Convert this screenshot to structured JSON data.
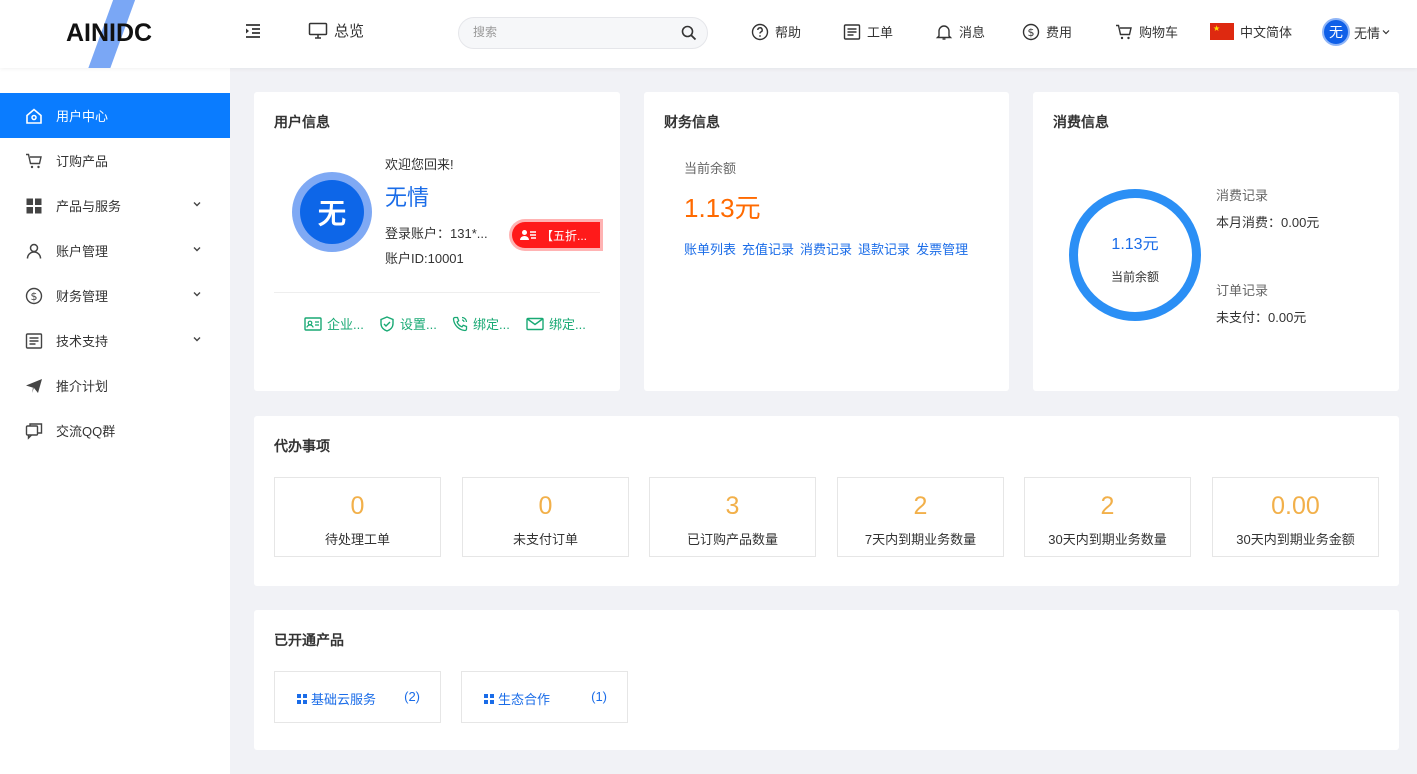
{
  "header": {
    "logo": "AINIDC",
    "overview": "总览",
    "search_placeholder": "搜索",
    "nav": {
      "help": "帮助",
      "ticket": "工单",
      "message": "消息",
      "cost": "费用",
      "cart": "购物车",
      "language": "中文简体",
      "user": "无情",
      "user_avatar": "无"
    }
  },
  "sidebar": {
    "items": [
      {
        "label": "用户中心",
        "icon": "home-icon",
        "active": true
      },
      {
        "label": "订购产品",
        "icon": "cart-icon"
      },
      {
        "label": "产品与服务",
        "icon": "grid-icon",
        "expandable": true
      },
      {
        "label": "账户管理",
        "icon": "user-icon",
        "expandable": true
      },
      {
        "label": "财务管理",
        "icon": "dollar-icon",
        "expandable": true
      },
      {
        "label": "技术支持",
        "icon": "document-icon",
        "expandable": true
      },
      {
        "label": "推介计划",
        "icon": "paper-plane-icon"
      },
      {
        "label": "交流QQ群",
        "icon": "chat-icon"
      }
    ]
  },
  "user_info": {
    "title": "用户信息",
    "welcome": "欢迎您回来!",
    "name": "无情",
    "avatar": "无",
    "account": "登录账户：131*...",
    "account_id": "账户ID:10001",
    "vip_badge": "【五折...",
    "quick_links": [
      "企业...",
      "设置...",
      "绑定...",
      "绑定..."
    ]
  },
  "finance": {
    "title": "财务信息",
    "balance_label": "当前余额",
    "balance": "1.13元",
    "links": [
      "账单列表",
      "充值记录",
      "消费记录",
      "退款记录",
      "发票管理"
    ]
  },
  "consumption": {
    "title": "消费信息",
    "ring_value": "1.13元",
    "ring_label": "当前余额",
    "consume_title": "消费记录",
    "consume_month": "本月消费：0.00元",
    "order_title": "订单记录",
    "order_unpaid": "未支付：0.00元"
  },
  "todo": {
    "title": "代办事项",
    "stats": [
      {
        "value": "0",
        "label": "待处理工单"
      },
      {
        "value": "0",
        "label": "未支付订单"
      },
      {
        "value": "3",
        "label": "已订购产品数量"
      },
      {
        "value": "2",
        "label": "7天内到期业务数量"
      },
      {
        "value": "2",
        "label": "30天内到期业务数量"
      },
      {
        "value": "0.00",
        "label": "30天内到期业务金额"
      }
    ]
  },
  "products": {
    "title": "已开通产品",
    "items": [
      {
        "name": "基础云服务",
        "count": "(2)"
      },
      {
        "name": "生态合作",
        "count": "(1)"
      }
    ]
  },
  "colors": {
    "primary": "#0a7cff",
    "link": "#1a6ce8",
    "amount": "#ff6a00",
    "stat": "#f2b04a",
    "quick": "#19a974",
    "badge": "#ff1a1a"
  }
}
